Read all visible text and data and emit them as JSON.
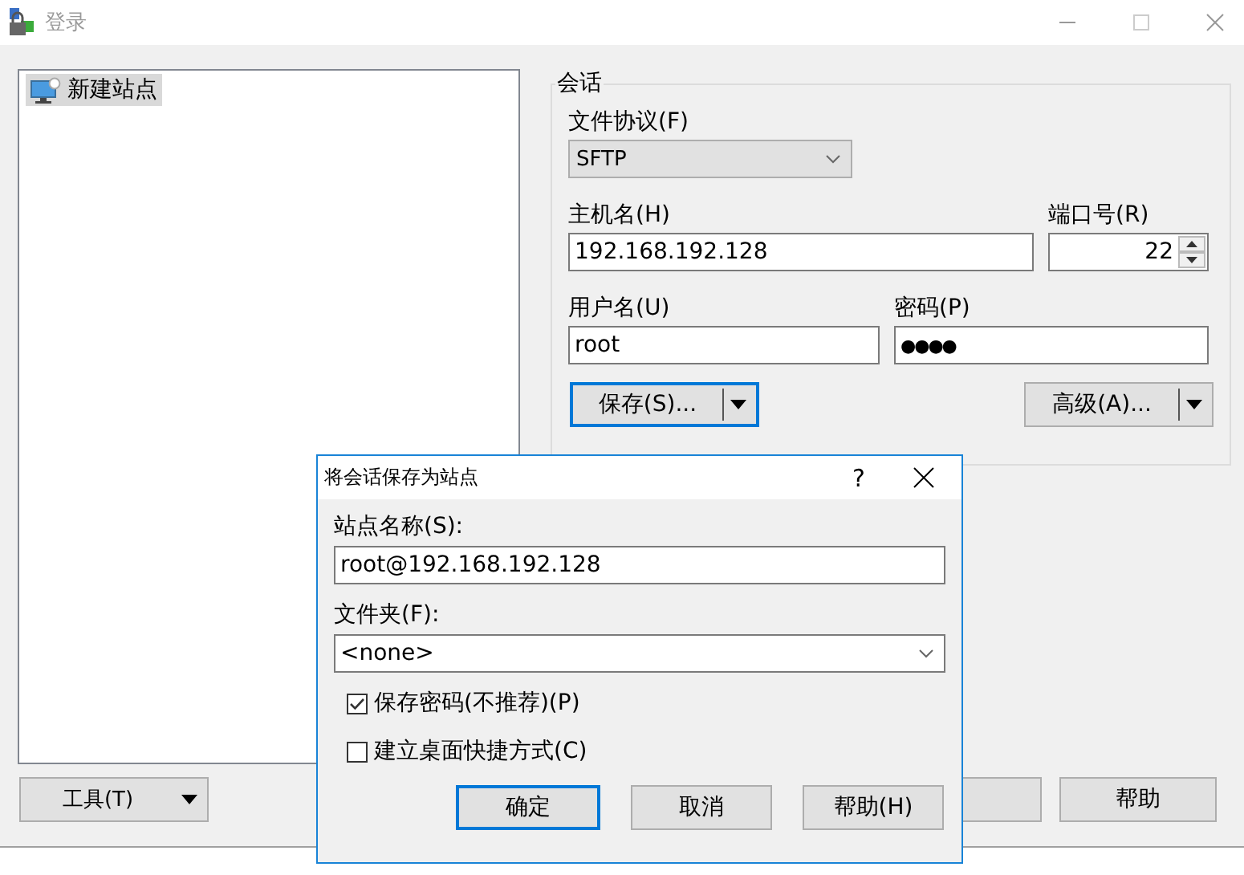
{
  "window": {
    "title": "登录",
    "active": false
  },
  "sites": {
    "items": [
      {
        "label": "新建站点",
        "selected": true
      }
    ]
  },
  "tools_button": {
    "label": "工具(T)"
  },
  "session": {
    "legend": "会话",
    "protocol": {
      "label": "文件协议(F)",
      "value": "SFTP"
    },
    "host": {
      "label": "主机名(H)",
      "value": "192.168.192.128"
    },
    "port": {
      "label": "端口号(R)",
      "value": "22"
    },
    "user": {
      "label": "用户名(U)",
      "value": "root"
    },
    "password": {
      "label": "密码(P)",
      "value": "●●●●"
    },
    "save_button": {
      "label": "保存(S)...",
      "focused": true
    },
    "advanced_button": {
      "label": "高级(A)...",
      "focused": false
    }
  },
  "help_button": {
    "label": "帮助"
  },
  "dialog": {
    "title": "将会话保存为站点",
    "help_glyph": "?",
    "site_name": {
      "label": "站点名称(S):",
      "value": "root@192.168.192.128"
    },
    "folder": {
      "label": "文件夹(F):",
      "value": "<none>"
    },
    "checkboxes": [
      {
        "label": "保存密码(不推荐)(P)",
        "checked": true
      },
      {
        "label": "建立桌面快捷方式(C)",
        "checked": false
      }
    ],
    "buttons": [
      {
        "label": "确定",
        "default": true
      },
      {
        "label": "取消",
        "default": false
      },
      {
        "label": "帮助(H)",
        "default": false
      }
    ]
  }
}
